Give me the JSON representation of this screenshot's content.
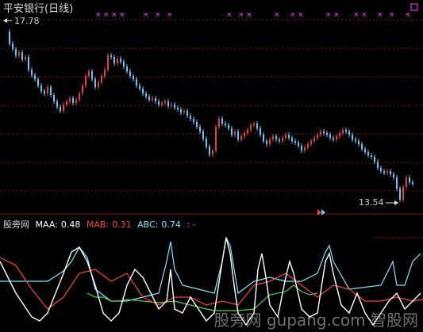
{
  "price_panel": {
    "title": "平安银行(日线)",
    "high_label": "17.78",
    "low_label": "13.54"
  },
  "indicator_panel": {
    "name": "股旁网",
    "maa_label": "MAA:",
    "maa_value": "0.48",
    "mab_label": "MAB:",
    "mab_value": "0.31",
    "abc_label": "ABC:",
    "abc_value": "0.74",
    "tail": ": -"
  },
  "watermark": "股旁网 gupang.com 智股网",
  "colors": {
    "up_candle": "#e04040",
    "down_candle": "#60c8ff",
    "grid": "#8a1010",
    "maa": "#ffffff",
    "mab": "#ff4040",
    "abc": "#80e8ff",
    "signal": "#ff40ff"
  },
  "icons": [
    "arrow-left-icon",
    "signal-marker-icon"
  ]
}
